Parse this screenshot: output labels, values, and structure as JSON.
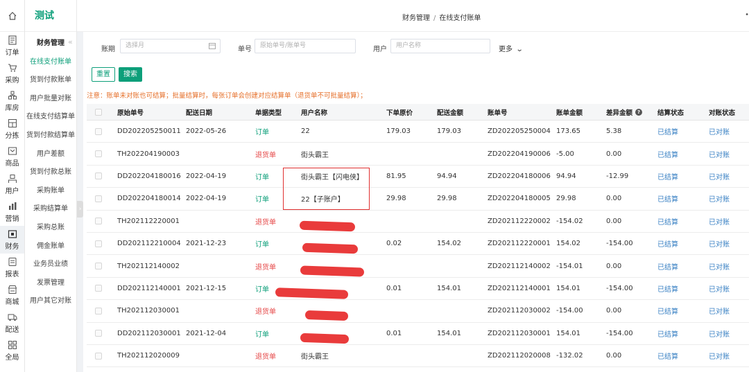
{
  "rail": {
    "items": [
      {
        "label": "订单",
        "icon": "order-icon"
      },
      {
        "label": "采购",
        "icon": "cart-icon"
      },
      {
        "label": "库房",
        "icon": "warehouse-icon"
      },
      {
        "label": "分拣",
        "icon": "sorting-icon"
      },
      {
        "label": "商品",
        "icon": "goods-icon"
      },
      {
        "label": "用户",
        "icon": "user-icon"
      },
      {
        "label": "营销",
        "icon": "marketing-icon"
      },
      {
        "label": "财务",
        "icon": "finance-icon"
      },
      {
        "label": "报表",
        "icon": "report-icon"
      },
      {
        "label": "商城",
        "icon": "mall-icon"
      },
      {
        "label": "配送",
        "icon": "delivery-icon"
      },
      {
        "label": "全局",
        "icon": "global-icon"
      }
    ]
  },
  "sidebar": {
    "brand": "测试",
    "collapse": "«",
    "section": "财务管理",
    "items": [
      "在线支付账单",
      "货到付款账单",
      "用户批量对账",
      "在线支付结算单",
      "货到付款结算单",
      "用户差额",
      "货到付款总账",
      "采购账单",
      "采购结算单",
      "采购总账",
      "佣金账单",
      "业务员业绩",
      "发票管理",
      "用户其它对账"
    ]
  },
  "header": {
    "crumb_parent": "财务管理",
    "crumb_sep": "/",
    "crumb_current": "在线支付账单"
  },
  "filters": {
    "period_label": "账期",
    "period_placeholder": "选择月",
    "number_label": "单号",
    "number_placeholder": "原始单号/账单号",
    "user_label": "用户",
    "user_placeholder": "用户名称",
    "more": "更多"
  },
  "buttons": {
    "reset": "重置",
    "search": "搜索"
  },
  "notice": "注意：账单未对账也可结算；批量结算时，每张订单会创建对应结算单（退货单不可批量结算）；",
  "table": {
    "columns": [
      "原始单号",
      "配送日期",
      "单据类型",
      "用户名称",
      "下单原价",
      "配送金额",
      "账单号",
      "账单金额",
      "差异金额",
      "结算状态",
      "对账状态"
    ],
    "rows": [
      {
        "orig": "DD202205250011",
        "date": "2022-05-26",
        "type": "订单",
        "user": "22",
        "price": "179.03",
        "delivery": "179.03",
        "bill": "ZD202205250004",
        "amount": "173.65",
        "diff": "5.38",
        "settle": "已结算",
        "check": "已对账"
      },
      {
        "orig": "TH202204190003",
        "date": "",
        "type": "退货单",
        "user": "街头霸王",
        "price": "",
        "delivery": "",
        "bill": "ZD202204190006",
        "amount": "-5.00",
        "diff": "0.00",
        "settle": "已结算",
        "check": "已对账"
      },
      {
        "orig": "DD202204180016",
        "date": "2022-04-19",
        "type": "订单",
        "user": "街头霸王【闪电侠】",
        "price": "81.95",
        "delivery": "94.94",
        "bill": "ZD202204180006",
        "amount": "94.94",
        "diff": "-12.99",
        "settle": "已结算",
        "check": "已对账"
      },
      {
        "orig": "DD202204180014",
        "date": "2022-04-19",
        "type": "订单",
        "user": "22【子账户】",
        "price": "29.98",
        "delivery": "29.98",
        "bill": "ZD202204180005",
        "amount": "29.98",
        "diff": "0.00",
        "settle": "已结算",
        "check": "已对账"
      },
      {
        "orig": "TH202112220001",
        "date": "",
        "type": "退货单",
        "user": "",
        "price": "",
        "delivery": "",
        "bill": "ZD202112220002",
        "amount": "-154.02",
        "diff": "0.00",
        "settle": "已结算",
        "check": "已对账"
      },
      {
        "orig": "DD202112210004",
        "date": "2021-12-23",
        "type": "订单",
        "user": "",
        "price": "0.02",
        "delivery": "154.02",
        "bill": "ZD202112220001",
        "amount": "154.02",
        "diff": "-154.00",
        "settle": "已结算",
        "check": "已对账"
      },
      {
        "orig": "TH202112140002",
        "date": "",
        "type": "退货单",
        "user": "",
        "price": "",
        "delivery": "",
        "bill": "ZD202112140002",
        "amount": "-154.01",
        "diff": "0.00",
        "settle": "已结算",
        "check": "已对账"
      },
      {
        "orig": "DD202112140001",
        "date": "2021-12-15",
        "type": "订单",
        "user": "",
        "price": "0.01",
        "delivery": "154.01",
        "bill": "ZD202112140001",
        "amount": "154.01",
        "diff": "-154.00",
        "settle": "已结算",
        "check": "已对账"
      },
      {
        "orig": "TH202112030001",
        "date": "",
        "type": "退货单",
        "user": "",
        "price": "",
        "delivery": "",
        "bill": "ZD202112030002",
        "amount": "-154.00",
        "diff": "0.00",
        "settle": "已结算",
        "check": "已对账"
      },
      {
        "orig": "DD202112030001",
        "date": "2021-12-04",
        "type": "订单",
        "user": "",
        "price": "0.01",
        "delivery": "154.01",
        "bill": "ZD202112030001",
        "amount": "154.01",
        "diff": "-154.00",
        "settle": "已结算",
        "check": "已对账"
      },
      {
        "orig": "TH202112020009",
        "date": "",
        "type": "退货单",
        "user": "街头霸王",
        "price": "",
        "delivery": "",
        "bill": "ZD202112020008",
        "amount": "-132.02",
        "diff": "0.00",
        "settle": "已结算",
        "check": "已对账"
      }
    ]
  },
  "colors": {
    "brand": "#0d9f7a",
    "return": "#e64a4a",
    "status": "#3b82c4",
    "notice": "#e6712c"
  }
}
